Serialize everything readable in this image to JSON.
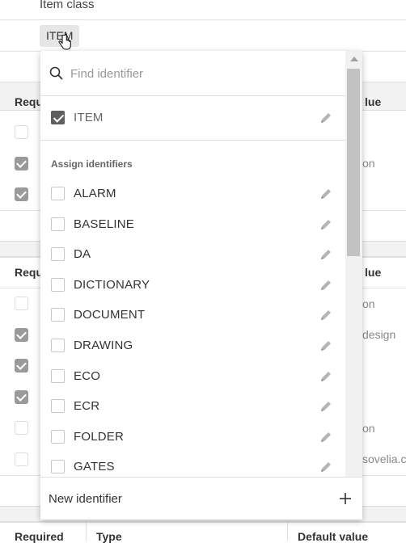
{
  "field": {
    "label": "Item class",
    "chip": "ITEM"
  },
  "table_headers": {
    "required": "Requ",
    "value": "lue"
  },
  "bottom_headers": {
    "required": "Required",
    "type": "Type",
    "default": "Default value"
  },
  "peek_text": {
    "r1": "on",
    "r2": "on",
    "r3": "design",
    "r4": "on",
    "r5": "sovelia.c"
  },
  "dropdown": {
    "search_placeholder": "Find identifier",
    "selected": [
      {
        "label": "ITEM",
        "checked": true
      }
    ],
    "section_title": "Assign identifiers",
    "options": [
      {
        "label": "ALARM",
        "checked": false
      },
      {
        "label": "BASELINE",
        "checked": false
      },
      {
        "label": "DA",
        "checked": false
      },
      {
        "label": "DICTIONARY",
        "checked": false
      },
      {
        "label": "DOCUMENT",
        "checked": false
      },
      {
        "label": "DRAWING",
        "checked": false
      },
      {
        "label": "ECO",
        "checked": false
      },
      {
        "label": "ECR",
        "checked": false
      },
      {
        "label": "FOLDER",
        "checked": false
      },
      {
        "label": "GATES",
        "checked": false
      }
    ],
    "footer_label": "New identifier"
  }
}
